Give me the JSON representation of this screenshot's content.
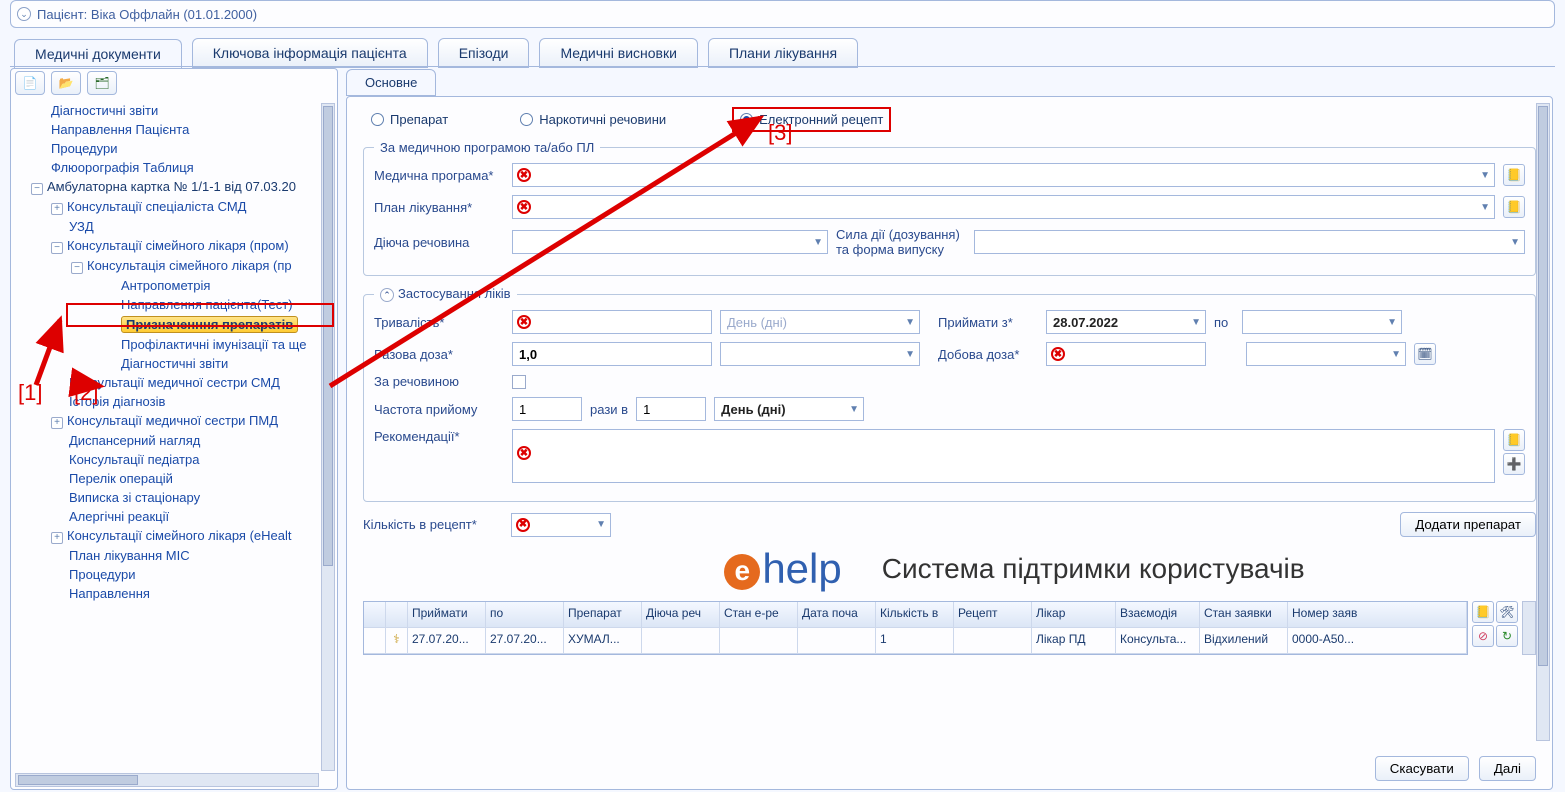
{
  "patient": {
    "label": "Пацієнт: Віка Оффлайн (01.01.2000)"
  },
  "top_tabs": {
    "t0": "Медичні документи",
    "t1": "Ключова інформація пацієнта",
    "t2": "Епізоди",
    "t3": "Медичні висновки",
    "t4": "Плани лікування"
  },
  "tree": {
    "i0": "Діагностичні звіти",
    "i1": "Направлення Пацієнта",
    "i2": "Процедури",
    "i3": "Флюорографія Таблиця",
    "i4": "Амбулаторна картка № 1/1-1 від 07.03.20",
    "i5": "Консультації спеціаліста СМД",
    "i6": "УЗД",
    "i7": "Консультації сімейного лікаря (пром)",
    "i8": "Консультація сімейного лікаря (пр",
    "i9": "Антропометрія",
    "i10": "Направлення пацієнта(Тест)",
    "i11": "Призначенння препаратів",
    "i12": "Профілактичні імунізації та ще",
    "i13": "Діагностичні звіти",
    "i14": "Консультації медичної сестри СМД",
    "i15": "Історія діагнозів",
    "i16": "Консультації медичної сестри ПМД",
    "i17": "Диспансерний нагляд",
    "i18": "Консультації педіатра",
    "i19": "Перелік операцій",
    "i20": "Виписка зі стаціонару",
    "i21": "Алергічні реакції",
    "i22": "Консультації сімейного лікаря (eHealt",
    "i23": "План лікування МІС",
    "i24": "Процедури",
    "i25": "Направлення"
  },
  "form": {
    "tab": "Основне",
    "radio": {
      "r0": "Препарат",
      "r1": "Наркотичні речовини",
      "r2": "Електронний рецепт"
    },
    "g1": {
      "legend": "За медичною програмою та/або ПЛ",
      "med_program": "Медична програма*",
      "plan": "План лікування*",
      "substance": "Діюча речовина",
      "strength": "Сила дії (дозування) та форма випуску"
    },
    "g2": {
      "legend": "Застосування ліків",
      "duration": "Тривалість*",
      "day_unit": "День (дні)",
      "take_from": "Приймати з*",
      "take_from_val": "28.07.2022",
      "to": "по",
      "single_dose": "Разова доза*",
      "single_dose_val": "1,0",
      "daily_dose": "Добова доза*",
      "by_substance": "За речовиною",
      "freq": "Частота прийому",
      "freq_times": "рази в",
      "freq_v1": "1",
      "freq_v2": "1",
      "freq_unit": "День (дні)",
      "recom": "Рекомендації*"
    },
    "qty": "Кількість в рецепт*",
    "add_btn": "Додати препарат",
    "banner_slogan": "Система підтримки користувачів",
    "logo_text": "help"
  },
  "grid": {
    "h": {
      "c0": "",
      "c1": "",
      "c2": "Приймати",
      "c3": "по",
      "c4": "Препарат",
      "c5": "Діюча реч",
      "c6": "Стан е-ре",
      "c7": "Дата поча",
      "c8": "Кількість в",
      "c9": "Рецепт",
      "c10": "Лікар",
      "c11": "Взаємодія",
      "c12": "Стан заявки",
      "c13": "Номер заяв"
    },
    "r0": {
      "c2": "27.07.20...",
      "c3": "27.07.20...",
      "c4": "ХУМАЛ...",
      "c5": "",
      "c6": "",
      "c7": "",
      "c8": "1",
      "c9": "",
      "c10": "Лікар ПД",
      "c11": "Консульта...",
      "c12": "Відхилений",
      "c13": "0000-A50..."
    }
  },
  "footer": {
    "cancel": "Скасувати",
    "next": "Далі"
  },
  "anno": {
    "a1": "[1]",
    "a2": "[2]",
    "a3": "[3]"
  }
}
